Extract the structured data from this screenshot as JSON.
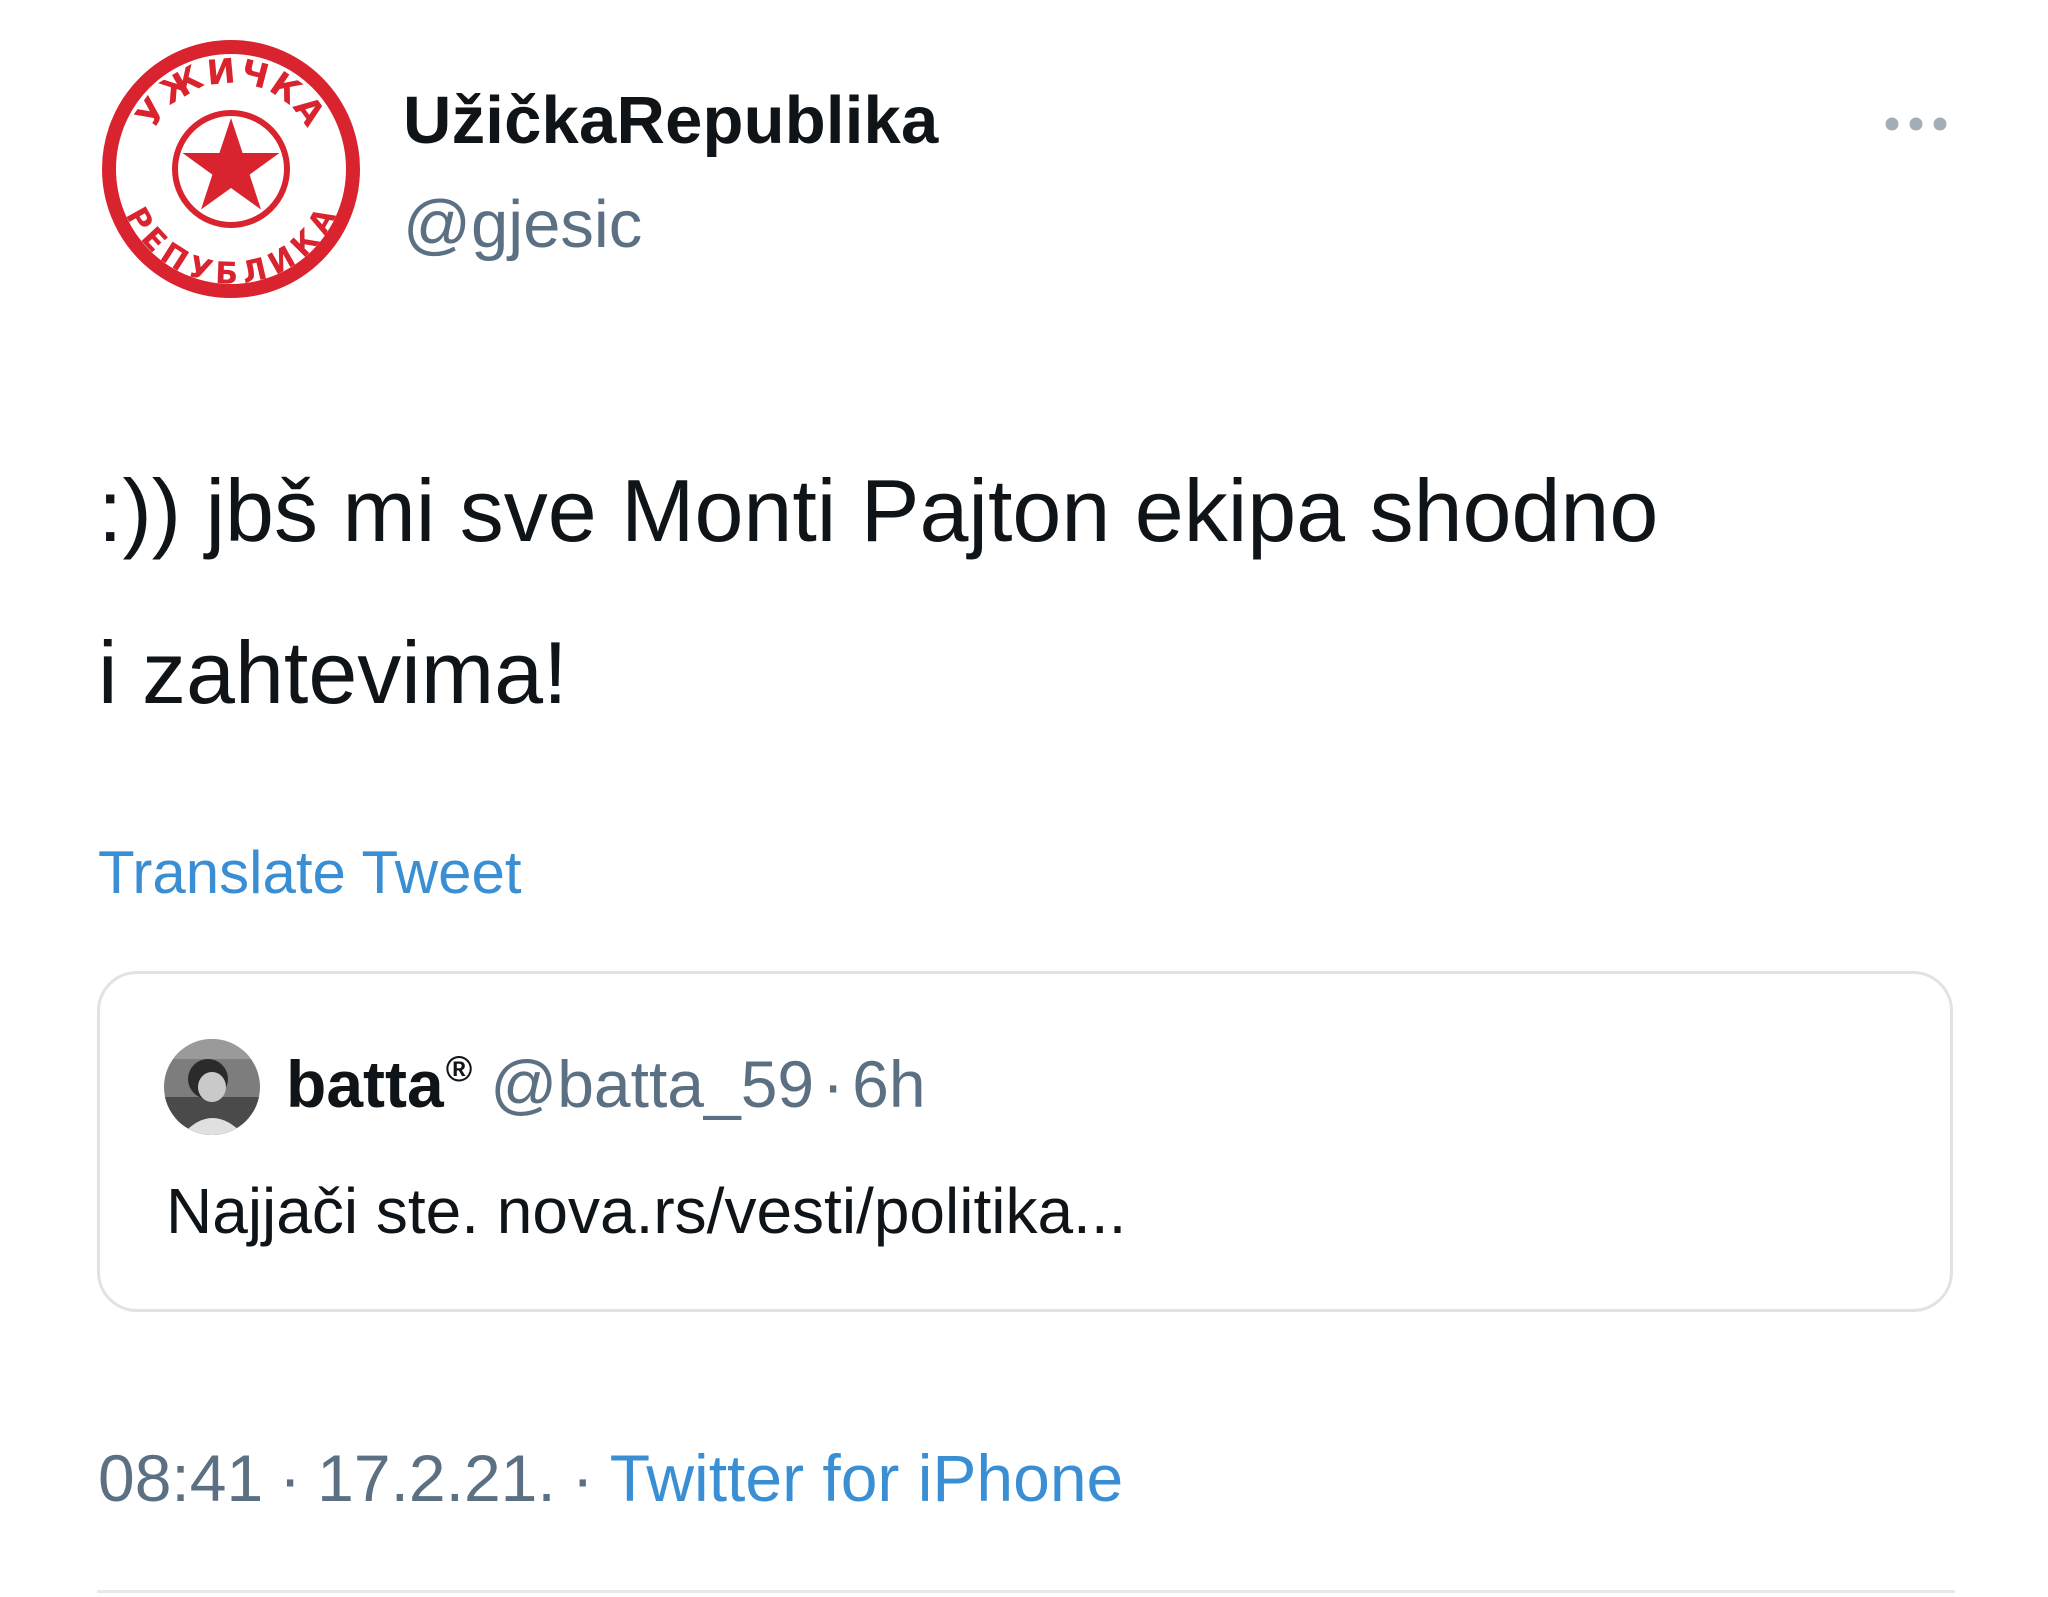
{
  "tweet": {
    "author": {
      "display_name": "UžičkaRepublika",
      "handle": "@gjesic",
      "avatar_logo_text_top": "УЖИЧКА",
      "avatar_logo_text_bottom": "РЕПУБЛИКА",
      "avatar_icon": "red-star-seal-icon"
    },
    "more_icon": "more-horizontal-icon",
    "text": ":)) jbš mi sve Monti Pajton ekipa shodno\ni zahtevima!",
    "translate_label": "Translate Tweet",
    "quoted": {
      "avatar_icon": "user-photo-avatar",
      "display_name": "batta",
      "badge": "®",
      "handle": "@batta_59",
      "separator": "·",
      "time": "6h",
      "text": "Najjači ste. nova.rs/vesti/politika..."
    },
    "meta": {
      "time": "08:41",
      "separator_1": "·",
      "date": "17.2.21.",
      "separator_2": "·",
      "source": "Twitter for iPhone"
    }
  },
  "colors": {
    "text_primary": "#0f1419",
    "text_secondary": "#5b7083",
    "link": "#3a8fd4",
    "border": "#dfe3e7",
    "seal_red": "#d9232e"
  }
}
